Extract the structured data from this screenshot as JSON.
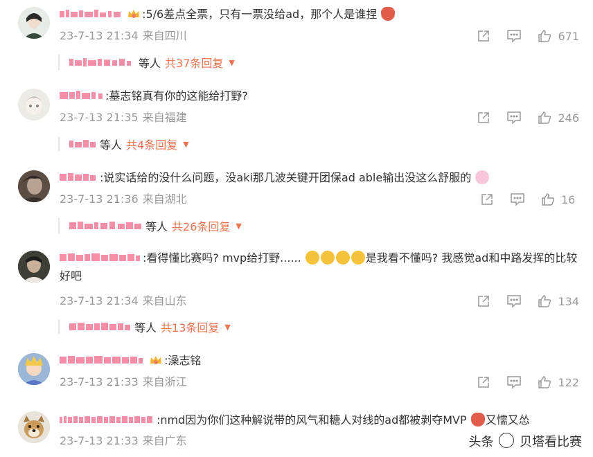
{
  "comments": [
    {
      "text": ":5/6差点全票，只有一票没给ad，那个人是谁捏",
      "time": "23-7-13 21:34",
      "location": "来自四川",
      "likes": "671",
      "reply_label": "等人",
      "reply_count": "共37条回复",
      "avatar_bg": "#dfe7e1"
    },
    {
      "text": ":墓志铭真有你的这能给打野?",
      "time": "23-7-13 21:35",
      "location": "来自福建",
      "likes": "246",
      "reply_label": "等人",
      "reply_count": "共4条回复",
      "avatar_bg": "#e6e3e0"
    },
    {
      "text": ":说实话给的没什么问题，没aki那几波关键开团保ad able输出没这么舒服的",
      "time": "23-7-13 21:36",
      "location": "来自湖北",
      "likes": "16",
      "reply_label": "等人",
      "reply_count": "共26条回复",
      "avatar_bg": "#6a5a50"
    },
    {
      "text": ":看得懂比赛吗? mvp给打野......",
      "text2": "是我看不懂吗? 我感觉ad和中路发挥的比较好吧",
      "time": "23-7-13 21:34",
      "location": "来自山东",
      "likes": "134",
      "reply_label": "等人",
      "reply_count": "共13条回复",
      "avatar_bg": "#4a4a3f"
    },
    {
      "text": ":澡志铭",
      "time": "23-7-13 21:33",
      "location": "来自浙江",
      "likes": "122",
      "avatar_bg": "#7fa0c8"
    },
    {
      "text": ":nmd因为你们这种解说带的风气和糖人对线的ad都被剥夺MVP",
      "text2": "又懦又怂",
      "time": "23-7-13 21:33",
      "location": "来自广东",
      "avatar_bg": "#c9a66b"
    }
  ],
  "watermark": {
    "prefix": "头条",
    "handle": "贝塔看比赛"
  },
  "colors": {
    "accent": "#eb7350",
    "meta": "#999999",
    "name_pink": "#f58fa8"
  }
}
